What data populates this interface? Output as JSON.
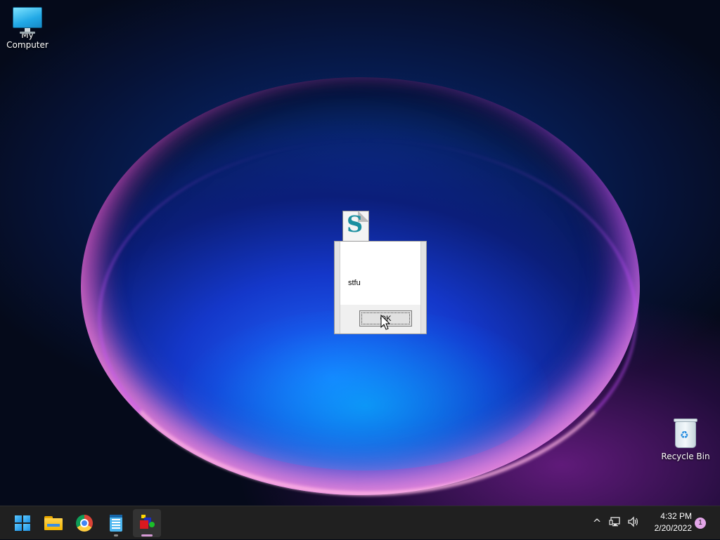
{
  "desktop": {
    "icons": [
      {
        "label": "My Computer",
        "icon": "computer-icon"
      },
      {
        "label": "Recycle Bin",
        "icon": "recycle-bin-icon"
      }
    ]
  },
  "dialog": {
    "icon": "script-file-icon",
    "message": "stfu",
    "ok_label": "OK"
  },
  "taskbar": {
    "apps": [
      {
        "name": "Start",
        "icon": "windows-start-icon"
      },
      {
        "name": "File Explorer",
        "icon": "folder-icon"
      },
      {
        "name": "Google Chrome",
        "icon": "chrome-icon"
      },
      {
        "name": "Notepad",
        "icon": "notepad-icon"
      },
      {
        "name": "Running app",
        "icon": "colored-blocks-app-icon",
        "active": true
      }
    ],
    "tray": {
      "chevron": "^",
      "network_icon": "network-icon",
      "volume_icon": "volume-icon",
      "time": "4:32 PM",
      "date": "2/20/2022",
      "notification_count": "1"
    }
  },
  "colors": {
    "taskbar_bg": "#202020",
    "active_indicator": "#d69ad6",
    "notification_badge": "#e3a6e8"
  }
}
